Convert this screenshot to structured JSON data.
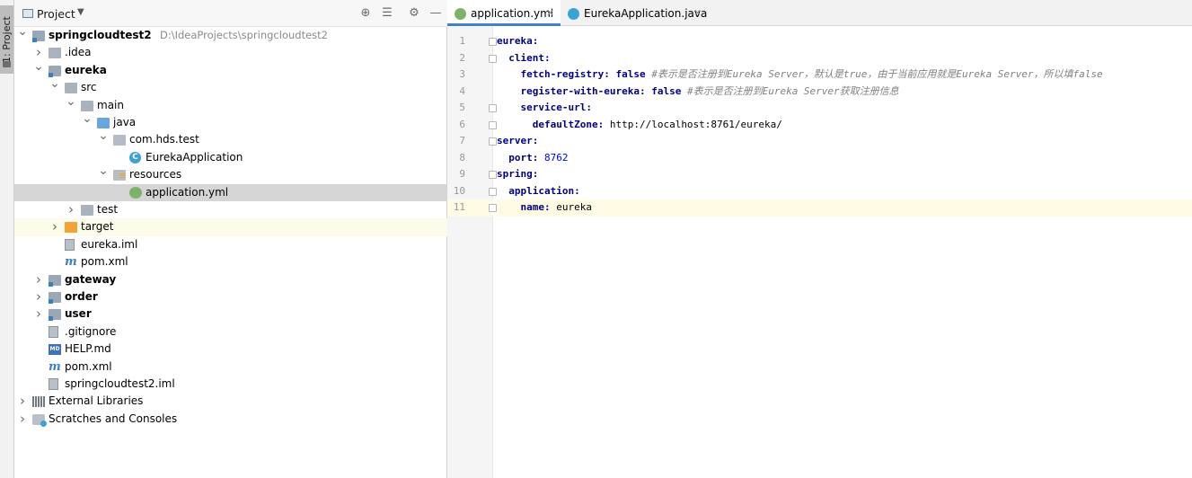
{
  "toolstrip": {
    "project_tab": "1: Project"
  },
  "project_panel": {
    "title": "Project",
    "tree": [
      {
        "label": "springcloudtest2",
        "path": "D:\\IdeaProjects\\springcloudtest2",
        "bold": true,
        "arrow": "down",
        "icon": "module"
      },
      {
        "label": ".idea",
        "arrow": "right",
        "icon": "folder"
      },
      {
        "label": "eureka",
        "bold": true,
        "arrow": "down",
        "icon": "module"
      },
      {
        "label": "src",
        "arrow": "down",
        "icon": "folder"
      },
      {
        "label": "main",
        "arrow": "down",
        "icon": "folder"
      },
      {
        "label": "java",
        "arrow": "down",
        "icon": "folder-blue"
      },
      {
        "label": "com.hds.test",
        "arrow": "down",
        "icon": "package"
      },
      {
        "label": "EurekaApplication",
        "icon": "class"
      },
      {
        "label": "resources",
        "arrow": "down",
        "icon": "resources"
      },
      {
        "label": "application.yml",
        "icon": "yml",
        "selected": true
      },
      {
        "label": "test",
        "arrow": "right",
        "icon": "folder"
      },
      {
        "label": "target",
        "arrow": "right",
        "icon": "folder-orange",
        "hover": true
      },
      {
        "label": "eureka.iml",
        "icon": "file"
      },
      {
        "label": "pom.xml",
        "icon": "maven"
      },
      {
        "label": "gateway",
        "bold": true,
        "arrow": "right",
        "icon": "module"
      },
      {
        "label": "order",
        "bold": true,
        "arrow": "right",
        "icon": "module"
      },
      {
        "label": "user",
        "bold": true,
        "arrow": "right",
        "icon": "module"
      },
      {
        "label": ".gitignore",
        "icon": "file"
      },
      {
        "label": "HELP.md",
        "icon": "md"
      },
      {
        "label": "pom.xml",
        "icon": "maven"
      },
      {
        "label": "springcloudtest2.iml",
        "icon": "file"
      },
      {
        "label": "External Libraries",
        "arrow": "right",
        "icon": "lib"
      },
      {
        "label": "Scratches and Consoles",
        "arrow": "right",
        "icon": "scratch"
      }
    ]
  },
  "editor": {
    "tabs": [
      {
        "label": "application.yml",
        "active": true
      },
      {
        "label": "EurekaApplication.java",
        "active": false
      }
    ],
    "lines": [
      {
        "num": "1",
        "tokens": [
          [
            "k",
            "eureka:"
          ]
        ]
      },
      {
        "num": "2",
        "tokens": [
          [
            "s",
            "  "
          ],
          [
            "k",
            "client:"
          ]
        ]
      },
      {
        "num": "3",
        "tokens": [
          [
            "s",
            "    "
          ],
          [
            "k",
            "fetch-registry: "
          ],
          [
            "v",
            "false "
          ],
          [
            "c",
            "#表示是否注册到Eureka Server，默认是true，由于当前应用就是Eureka Server，所以填false"
          ]
        ]
      },
      {
        "num": "4",
        "tokens": [
          [
            "s",
            "    "
          ],
          [
            "k",
            "register-with-eureka: "
          ],
          [
            "v",
            "false "
          ],
          [
            "c",
            "#表示是否注册到Eureka Server获取注册信息"
          ]
        ]
      },
      {
        "num": "5",
        "tokens": [
          [
            "s",
            "    "
          ],
          [
            "k",
            "service-url:"
          ]
        ]
      },
      {
        "num": "6",
        "tokens": [
          [
            "s",
            "      "
          ],
          [
            "k",
            "defaultZone: "
          ],
          [
            "s",
            "http://localhost:8761/eureka/"
          ]
        ]
      },
      {
        "num": "7",
        "tokens": [
          [
            "k",
            "server:"
          ]
        ]
      },
      {
        "num": "8",
        "tokens": [
          [
            "s",
            "  "
          ],
          [
            "k",
            "port: "
          ],
          [
            "n",
            "8762"
          ]
        ]
      },
      {
        "num": "9",
        "tokens": [
          [
            "k",
            "spring:"
          ]
        ]
      },
      {
        "num": "10",
        "tokens": [
          [
            "s",
            "  "
          ],
          [
            "k",
            "application:"
          ]
        ]
      },
      {
        "num": "11",
        "tokens": [
          [
            "s",
            "    "
          ],
          [
            "k",
            "name: "
          ],
          [
            "s",
            "eureka"
          ]
        ],
        "current": true
      }
    ]
  }
}
